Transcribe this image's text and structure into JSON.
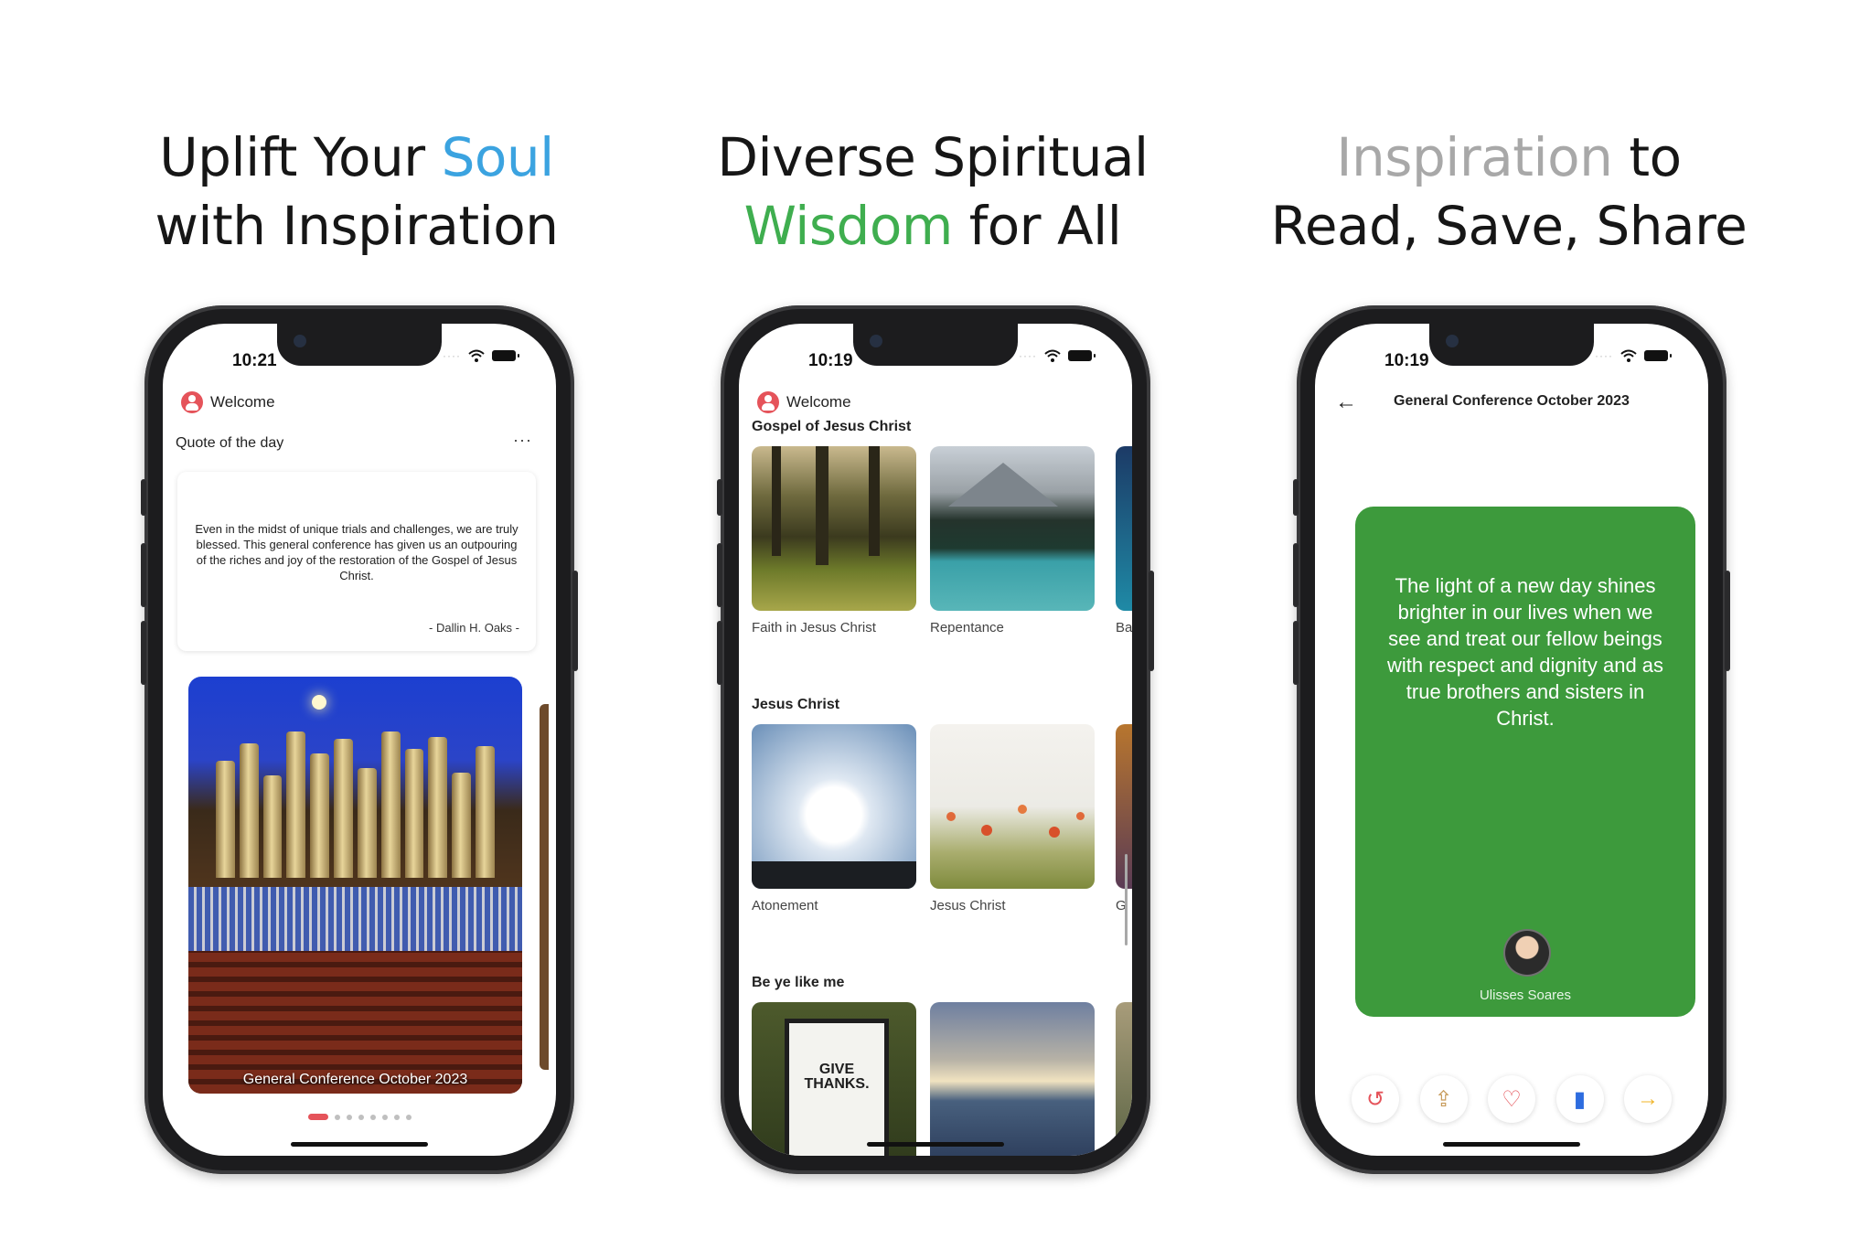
{
  "headlines": [
    {
      "line1_a": "Uplift Your ",
      "line1_b": "Soul",
      "line2": "with Inspiration"
    },
    {
      "line1": "Diverse Spiritual",
      "line2_a": "Wisdom",
      "line2_b": " for All"
    },
    {
      "line1_a": "Inspiration",
      "line1_b": " to",
      "line2": "Read, Save, Share"
    }
  ],
  "colors": {
    "soul_blue": "#3ba3e0",
    "wisdom_green": "#3fae4f",
    "inspiration_gray": "#a8a8a8",
    "accent_red": "#e5535a",
    "card_green": "#3d9a3c"
  },
  "phone1": {
    "time": "10:21",
    "welcome": "Welcome",
    "quote_section": "Quote of the day",
    "more_icon": "···",
    "quote_text": "Even in the midst of unique trials and challenges, we are truly blessed. This general conference has given us an outpouring of the riches and joy of the restoration of the Gospel of Jesus Christ.",
    "quote_author": "- Dallin H. Oaks -",
    "hero_caption": "General Conference October 2023"
  },
  "phone2": {
    "time": "10:19",
    "welcome": "Welcome",
    "sections": [
      {
        "title": "Gospel of Jesus Christ",
        "items": [
          "Faith in Jesus Christ",
          "Repentance"
        ],
        "peek": "Ba"
      },
      {
        "title": "Jesus Christ",
        "items": [
          "Atonement",
          "Jesus Christ"
        ],
        "peek": "G"
      },
      {
        "title": "Be ye like me",
        "items": [
          "",
          ""
        ],
        "peek": ""
      }
    ],
    "sign_text_1": "GIVE",
    "sign_text_2": "THANKS."
  },
  "phone3": {
    "time": "10:19",
    "back_icon": "←",
    "title": "General Conference October 2023",
    "card_quote": "The light of a new day shines brighter in our lives when we see and treat our fellow beings with respect and dignity and as true brothers and sisters in Christ.",
    "author": "Ulisses Soares",
    "actions": [
      {
        "icon": "↺",
        "color": "#e5535a"
      },
      {
        "icon": "⇪",
        "color": "#c79a5a"
      },
      {
        "icon": "♡",
        "color": "#e5535a"
      },
      {
        "icon": "▮",
        "color": "#2d6cdf"
      },
      {
        "icon": "→",
        "color": "#f0b429"
      }
    ]
  }
}
